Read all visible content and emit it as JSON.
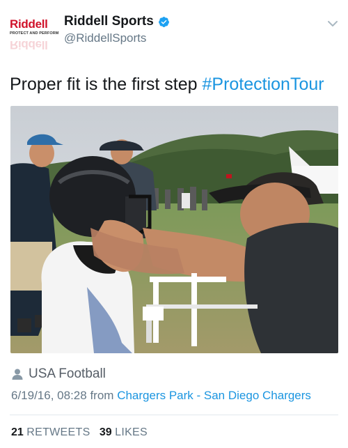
{
  "header": {
    "logo": {
      "brand": "Riddell",
      "tagline": "PROTECT AND PERFORM"
    },
    "display_name": "Riddell Sports",
    "handle": "@RiddellSports",
    "verified_icon": "verified-badge-icon",
    "menu_icon": "chevron-down-icon"
  },
  "tweet": {
    "text_before": "Proper fit is the first step ",
    "hashtag": "#ProtectionTour"
  },
  "photo": {
    "subject": "football helmet fitting photo"
  },
  "location": {
    "icon": "person-icon",
    "label": "USA Football"
  },
  "meta": {
    "timestamp": "6/19/16, 08:28",
    "from": "from",
    "source": "Chargers Park - San Diego Chargers"
  },
  "stats": {
    "retweets_count": "21",
    "retweets_label": "RETWEETS",
    "likes_count": "39",
    "likes_label": "LIKES"
  },
  "colors": {
    "link": "#1b95e0",
    "brand_red": "#d0122a",
    "secondary_text": "#657786"
  }
}
